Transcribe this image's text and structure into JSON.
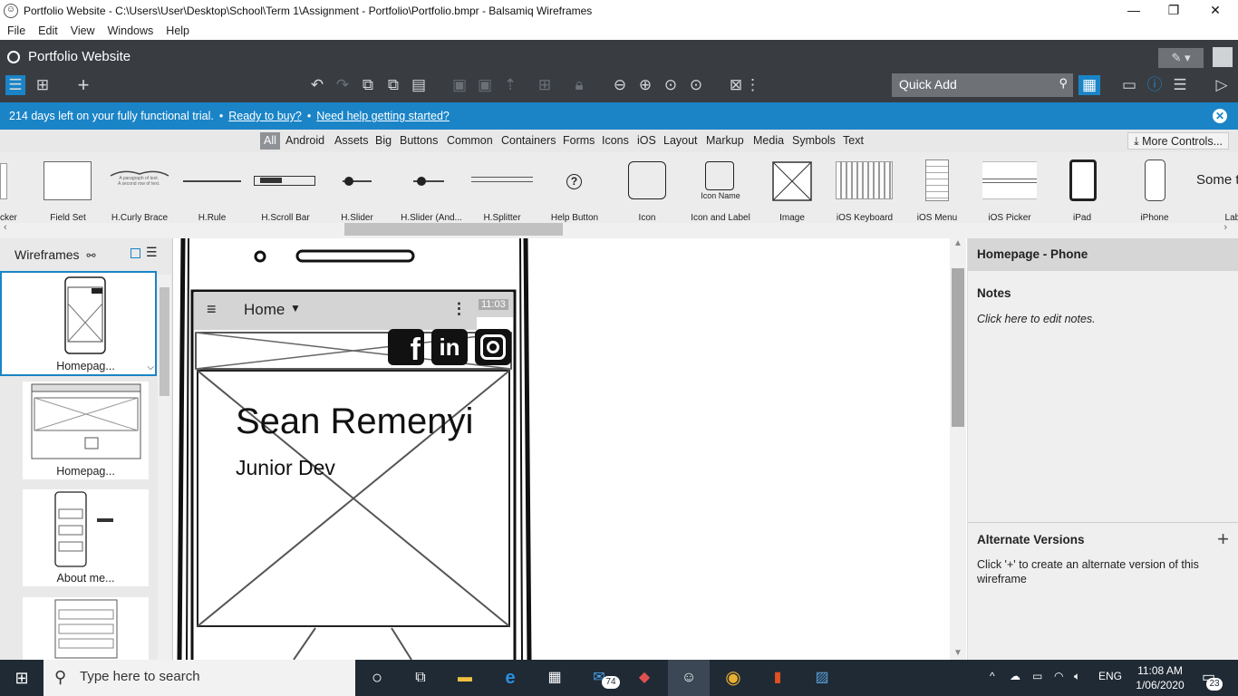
{
  "window": {
    "title": "Portfolio Website - C:\\Users\\User\\Desktop\\School\\Term 1\\Assignment - Portfolio\\Portfolio.bmpr - Balsamiq Wireframes",
    "minimize": "—",
    "restore": "❐",
    "close": "✕"
  },
  "menu": [
    "File",
    "Edit",
    "View",
    "Windows",
    "Help"
  ],
  "project": {
    "name": "Portfolio Website"
  },
  "toolbar": {
    "quick_add_placeholder": "Quick Add"
  },
  "trial": {
    "days_text": "214 days left on your fully functional trial.",
    "buy_link": "Ready to buy?",
    "help_link": "Need help getting started?"
  },
  "categories": [
    "All",
    "Android",
    "Assets",
    "Big",
    "Buttons",
    "Common",
    "Containers",
    "Forms",
    "Icons",
    "iOS",
    "Layout",
    "Markup",
    "Media",
    "Symbols",
    "Text"
  ],
  "more_controls": "More Controls...",
  "palette": {
    "items": [
      "cker",
      "Field Set",
      "H.Curly Brace",
      "H.Rule",
      "H.Scroll Bar",
      "H.Slider",
      "H.Slider (And...",
      "H.Splitter",
      "Help Button",
      "Icon",
      "Icon and Label",
      "Image",
      "iOS Keyboard",
      "iOS Menu",
      "iOS Picker",
      "iPad",
      "iPhone",
      "Label"
    ],
    "icon_label_preview": "Icon Name",
    "label_preview": "Some t"
  },
  "wireframes_panel": {
    "title": "Wireframes",
    "thumbs": [
      "Homepag...",
      "Homepag...",
      "About me...",
      ""
    ]
  },
  "canvas": {
    "nav_title": "Home",
    "time": "11:03",
    "heading": "Sean Remenyi",
    "subheading": "Junior Dev",
    "social_icons": [
      "facebook-icon",
      "linkedin-icon",
      "instagram-icon"
    ]
  },
  "properties": {
    "header": "Homepage - Phone",
    "notes_title": "Notes",
    "notes_placeholder": "Click here to edit notes.",
    "alt_title": "Alternate Versions",
    "alt_text": "Click '+' to create an alternate version of this wireframe"
  },
  "taskbar": {
    "search_placeholder": "Type here to search",
    "mail_badge": "74",
    "lang": "ENG",
    "time": "11:08 AM",
    "date": "1/06/2020",
    "notif_count": "23"
  }
}
